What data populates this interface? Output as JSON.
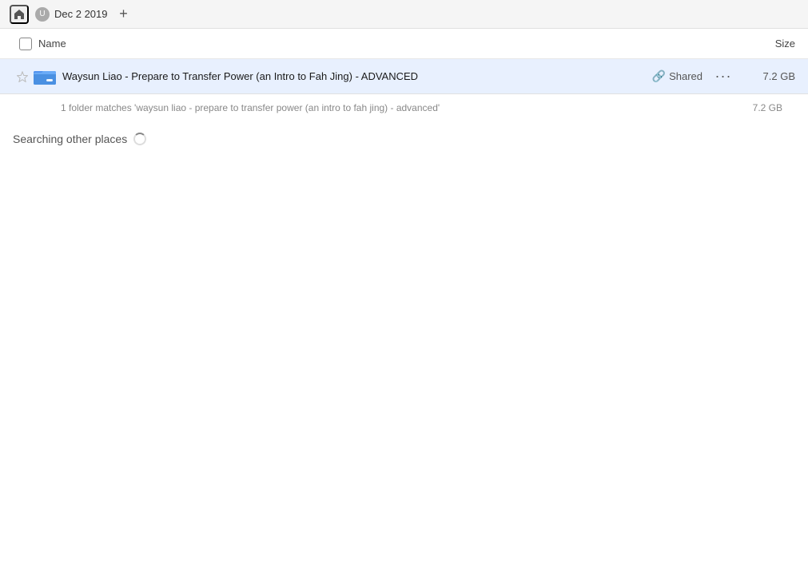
{
  "topbar": {
    "date_label": "Dec 2 2019",
    "add_tab_label": "+"
  },
  "columns": {
    "name_label": "Name",
    "size_label": "Size"
  },
  "file_row": {
    "name": "Waysun Liao - Prepare to Transfer Power (an Intro to Fah Jing) - ADVANCED",
    "shared_label": "Shared",
    "size": "7.2 GB",
    "more_label": "···"
  },
  "status": {
    "match_text": "1 folder matches 'waysun liao - prepare to transfer power (an intro to fah jing) - advanced'",
    "match_size": "7.2 GB"
  },
  "searching": {
    "label": "Searching other places"
  }
}
